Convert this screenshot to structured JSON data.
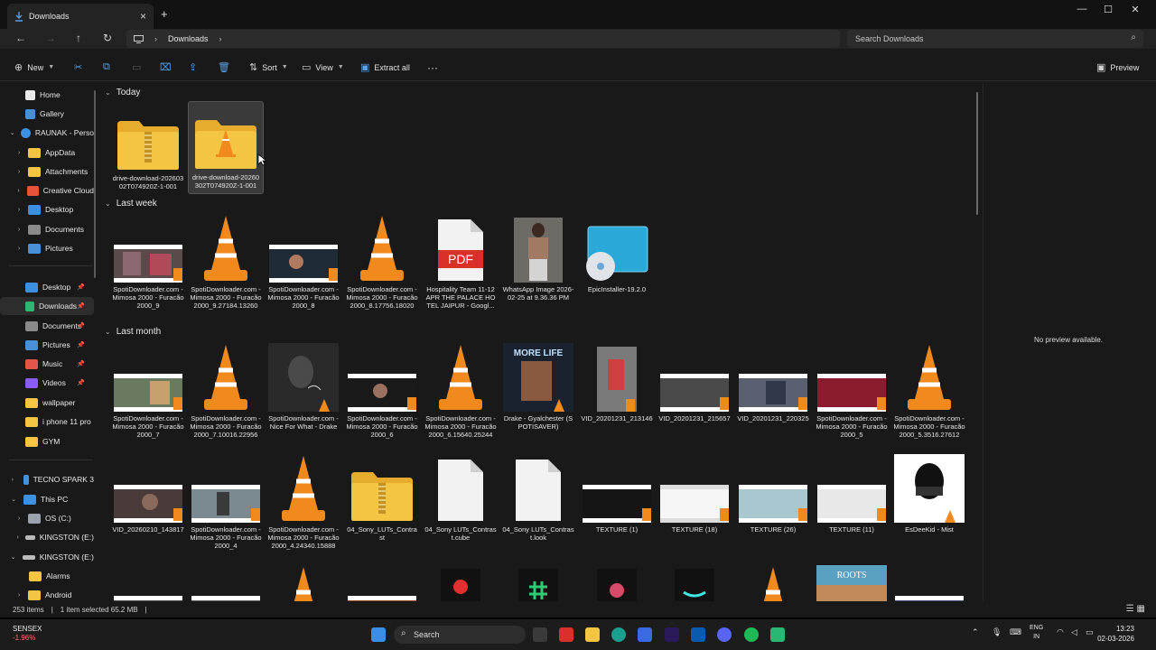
{
  "tab": {
    "title": "Downloads"
  },
  "address": {
    "crumb": "Downloads",
    "search_placeholder": "Search Downloads"
  },
  "toolbar": {
    "new": "New",
    "sort": "Sort",
    "view": "View",
    "extract_all": "Extract all",
    "more": "···",
    "preview": "Preview"
  },
  "sidebar": {
    "home": "Home",
    "gallery": "Gallery",
    "onedrive": "RAUNAK - Perso",
    "appdata": "AppData",
    "attachments": "Attachments",
    "creative": "Creative Cloud",
    "desktop_od": "Desktop",
    "documents_od": "Documents",
    "pictures_od": "Pictures",
    "desktop": "Desktop",
    "downloads": "Downloads",
    "documents": "Documents",
    "pictures": "Pictures",
    "music": "Music",
    "videos": "Videos",
    "wallpaper": "wallpaper",
    "iphone": "i phone 11 pro",
    "gym": "GYM",
    "tecno": "TECNO SPARK 3",
    "thispc": "This PC",
    "osc": "OS (C:)",
    "kingston1": "KINGSTON (E:)",
    "kingston2": "KINGSTON (E:)",
    "alarms": "Alarms",
    "android": "Android"
  },
  "groups": {
    "today": "Today",
    "last_week": "Last week",
    "last_month": "Last month"
  },
  "files": {
    "t1": "drive-download-20260302T074920Z-1-001",
    "t2": "drive-download-20260302T074920Z-1-001",
    "w1": "SpotiDownloader.com - Mimosa 2000 - Furacão 2000_9",
    "w2": "SpotiDownloader.com - Mimosa 2000 - Furacão 2000_9.27184.13260",
    "w3": "SpotiDownloader.com - Mimosa 2000 - Furacão 2000_8",
    "w4": "SpotiDownloader.com - Mimosa 2000 - Furacão 2000_8.17756.18020",
    "w5": "Hospitality Team 11-12 APR THE PALACE HOTEL JAIPUR - Googl...",
    "w6": "WhatsApp Image 2026-02-25 at 9.36.36 PM",
    "w7": "EpicInstaller-19.2.0",
    "m1": "SpotiDownloader.com - Mimosa 2000 - Furacão 2000_7",
    "m2": "SpotiDownloader.com - Mimosa 2000 - Furacão 2000_7.10016.22956",
    "m3": "SpotiDownloader.com - Nice For What - Drake",
    "m4": "SpotiDownloader.com - Mimosa 2000 - Furacão 2000_6",
    "m5": "SpotiDownloader.com - Mimosa 2000 - Furacão 2000_6.15640.25244",
    "m6": "Drake - Gyalchester (SPOTISAVER)",
    "m7": "VID_20201231_213146",
    "m8": "VID_20201231_215657",
    "m9": "VID_20201231_220325",
    "m10": "SpotiDownloader.com - Mimosa 2000 - Furacão 2000_5",
    "m11": "SpotiDownloader.com - Mimosa 2000 - Furacão 2000_5.3516.27612",
    "n1": "VID_20260210_143817",
    "n2": "SpotiDownloader.com - Mimosa 2000 - Furacão 2000_4",
    "n3": "SpotiDownloader.com - Mimosa 2000 - Furacão 2000_4.24340.15888",
    "n4": "04_Sony_LUTs_Contrast",
    "n5": "04_Sony LUTs_Contrast.cube",
    "n6": "04_Sony LUTs_Contrast.look",
    "n7": "TEXTURE (1)",
    "n8": "TEXTURE (18)",
    "n9": "TEXTURE (26)",
    "n10": "TEXTURE (11)",
    "n11": "EsDeeKid - Mist"
  },
  "thumb_text": {
    "pdf": "PDF",
    "album": "MORE LIFE",
    "roots": "ROOTS"
  },
  "preview_text": "No preview available.",
  "status": {
    "items": "253 items",
    "selected": "1 item selected  65.2 MB"
  },
  "taskbar": {
    "sensex_label": "SENSEX",
    "sensex_value": "-1.96%",
    "search": "Search",
    "lang1": "ENG",
    "lang2": "IN",
    "time": "13:23",
    "date": "02-03-2026"
  },
  "colors": {
    "accent": "#5aa0e6",
    "folder": "#f4c542",
    "vlc": "#f18a1c",
    "pdf": "#d9302a",
    "negative": "#ff6b6b"
  }
}
